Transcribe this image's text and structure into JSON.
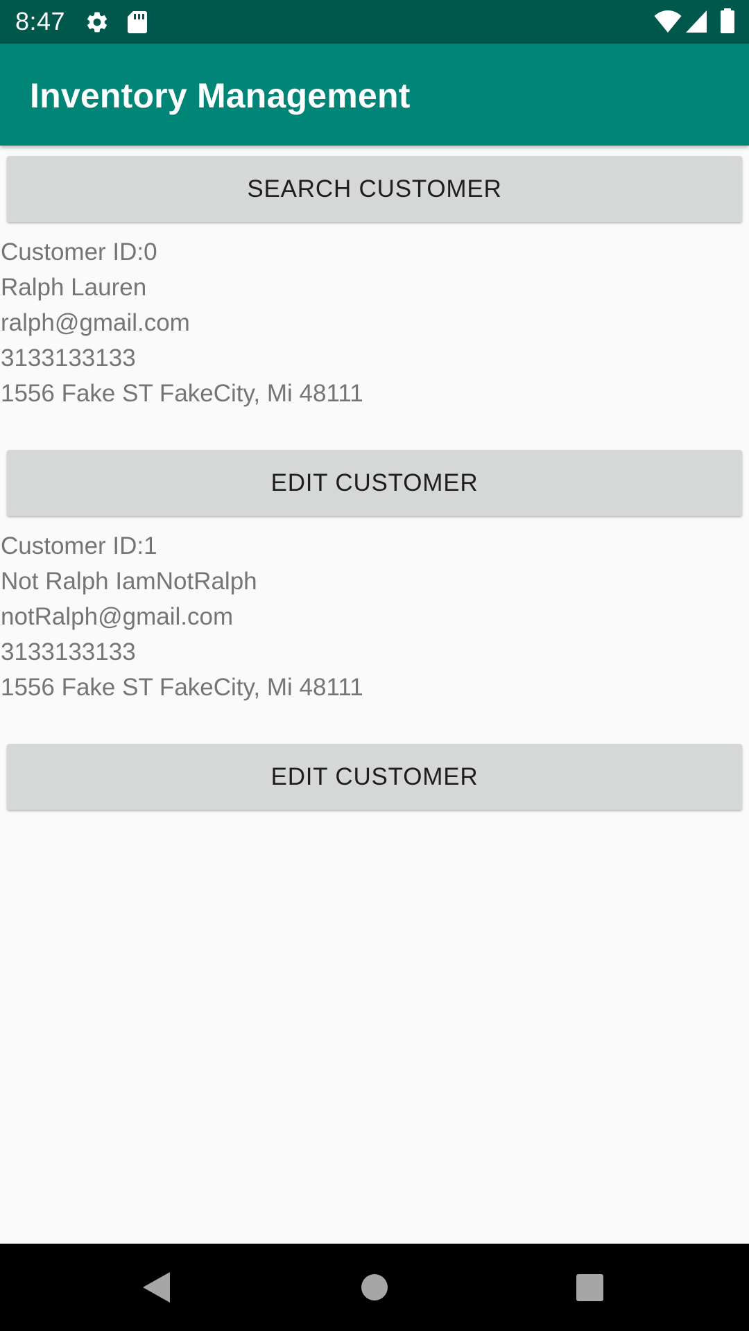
{
  "status_bar": {
    "time": "8:47",
    "icons": [
      "gear-icon",
      "sd-card-icon",
      "wifi-icon",
      "signal-icon",
      "battery-icon"
    ]
  },
  "app_bar": {
    "title": "Inventory Management",
    "color": "#008577"
  },
  "search_button": {
    "label": "SEARCH CUSTOMER"
  },
  "customers": [
    {
      "id_line": "Customer ID:0",
      "name": "Ralph Lauren",
      "email": "ralph@gmail.com",
      "phone": "3133133133",
      "address": "1556 Fake ST FakeCity, Mi 48111",
      "edit_label": "EDIT CUSTOMER"
    },
    {
      "id_line": "Customer ID:1",
      "name": "Not Ralph IamNotRalph",
      "email": "notRalph@gmail.com",
      "phone": "3133133133",
      "address": "1556 Fake ST FakeCity, Mi 48111",
      "edit_label": "EDIT CUSTOMER"
    }
  ],
  "nav_bar": {
    "icons": [
      "back-icon",
      "home-icon",
      "recents-icon"
    ]
  }
}
